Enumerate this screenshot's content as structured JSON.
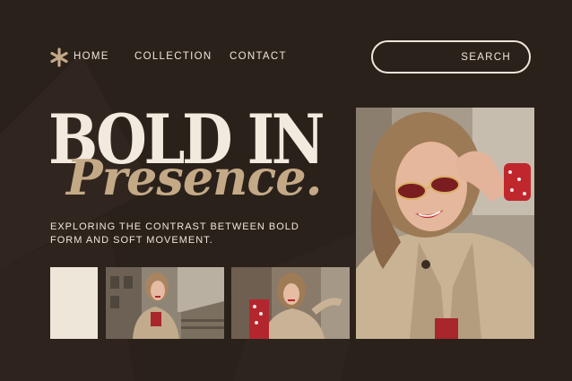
{
  "nav": {
    "logo_icon": "asterisk-icon",
    "links": [
      "HOME",
      "COLLECTION",
      "CONTACT"
    ]
  },
  "search": {
    "label": "SEARCH",
    "placeholder": ""
  },
  "hero": {
    "headline_line1": "BOLD IN",
    "headline_line2": "Presence.",
    "subtitle": "EXPLORING THE CONTRAST BETWEEN BOLD FORM AND SOFT MOVEMENT."
  },
  "colors": {
    "background": "#2a211b",
    "cream": "#efe6da",
    "tan_accent": "#c4a987",
    "red_accent": "#c0272d"
  }
}
